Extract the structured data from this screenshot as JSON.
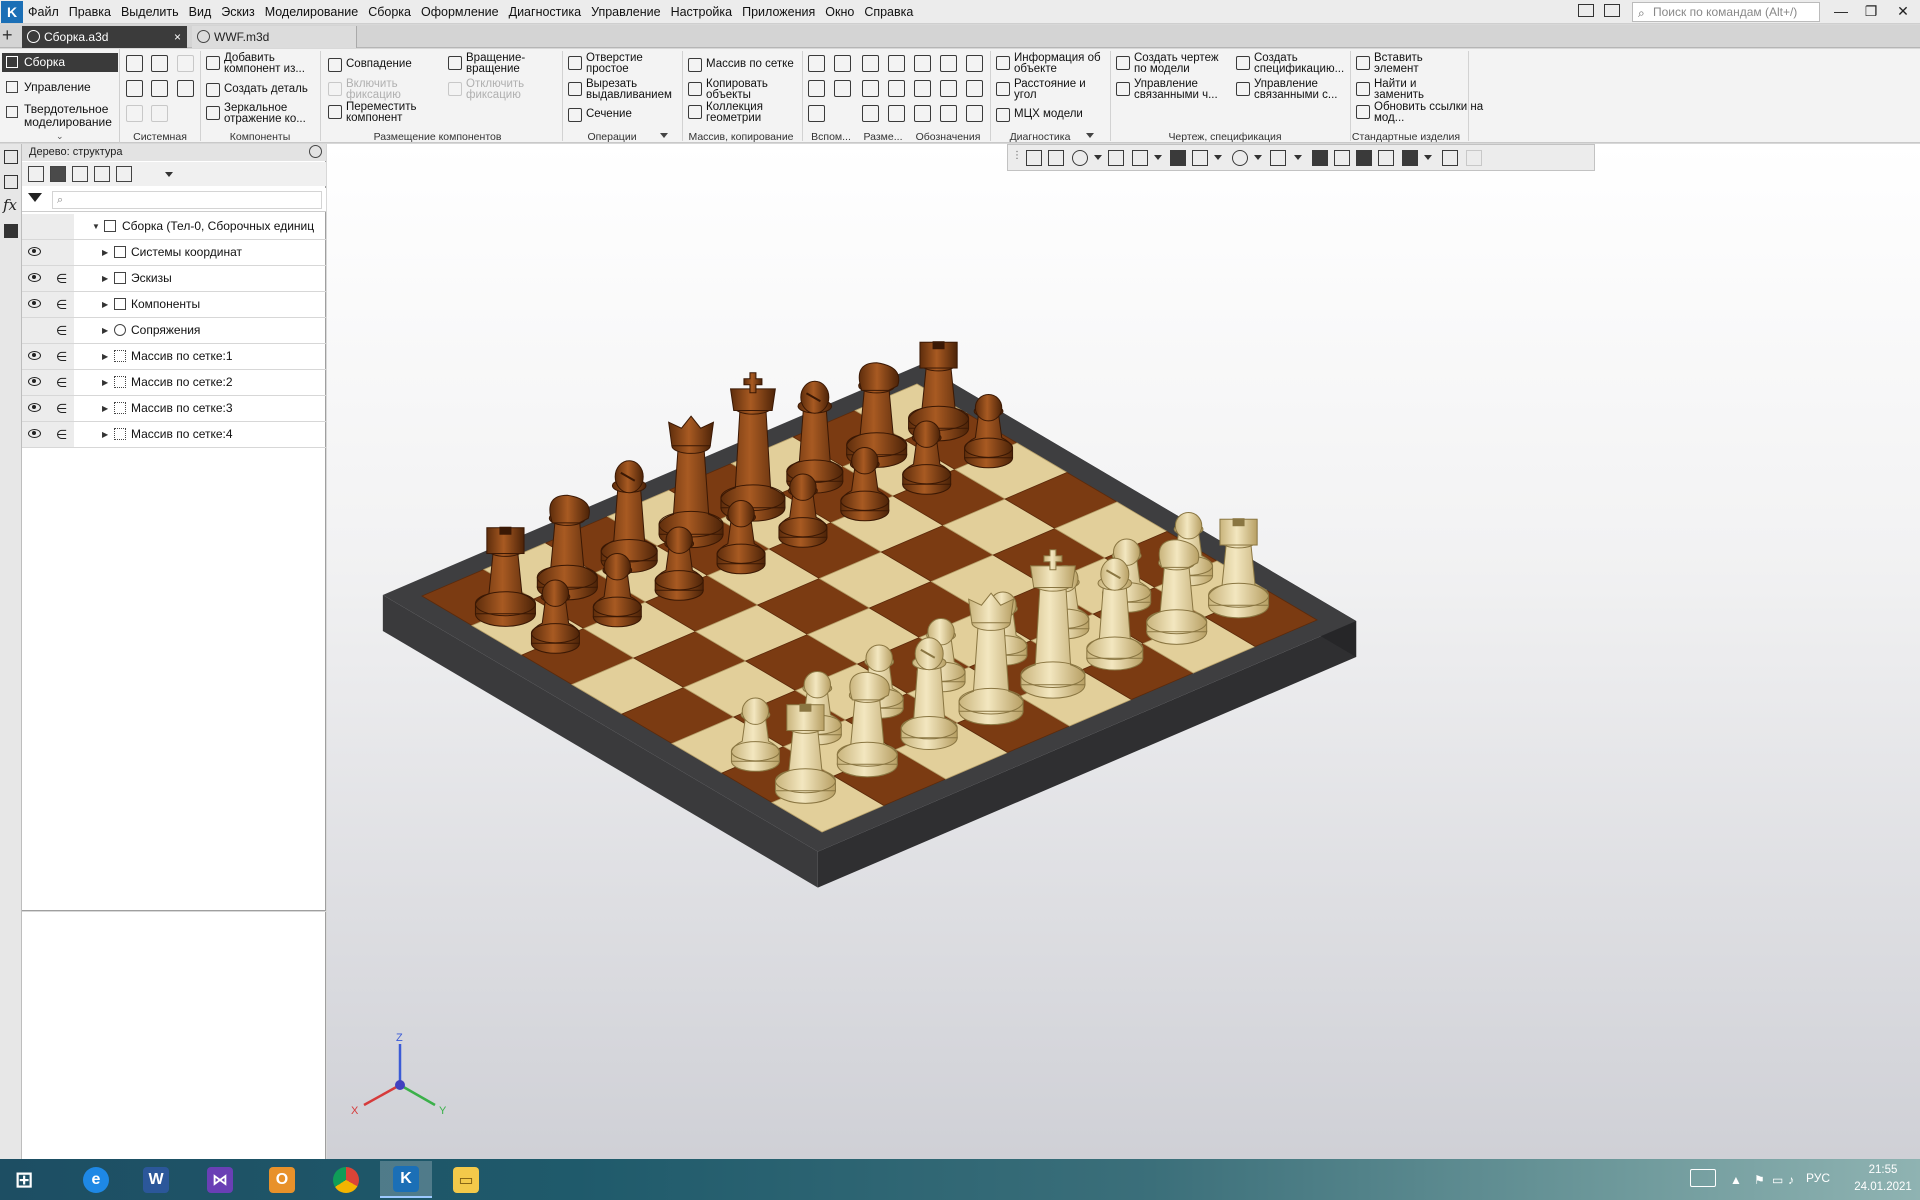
{
  "menubar": {
    "items": [
      "Файл",
      "Правка",
      "Выделить",
      "Вид",
      "Эскиз",
      "Моделирование",
      "Сборка",
      "Оформление",
      "Диагностика",
      "Управление",
      "Настройка",
      "Приложения",
      "Окно",
      "Справка"
    ],
    "search_placeholder": "Поиск по командам (Alt+/)"
  },
  "tabs": [
    {
      "label": "Сборка.a3d",
      "close": "×"
    },
    {
      "label": "WWF.m3d"
    }
  ],
  "ribbon": {
    "modes": [
      "Сборка",
      "Управление",
      "Твердотельное моделирование"
    ],
    "commands": {
      "add_component": "Добавить компонент из...",
      "create_part": "Создать деталь",
      "mirror": "Зеркальное отражение ко...",
      "coincidence": "Совпадение",
      "enable_fix": "Включить фиксацию",
      "move_component": "Переместить компонент",
      "rotation": "Вращение-вращение",
      "disable_fix": "Отключить фиксацию",
      "simple_hole": "Отверстие простое",
      "extrude_cut": "Вырезать выдавливанием",
      "section": "Сечение",
      "grid_array": "Массив по сетке",
      "copy_objects": "Копировать объекты",
      "geom_collection": "Коллекция геометрии",
      "object_info": "Информация об объекте",
      "distance_angle": "Расстояние и угол",
      "mass_props": "МЦХ модели",
      "create_drawing": "Создать чертеж по модели",
      "manage_linked_1": "Управление связанными ч...",
      "create_spec": "Создать спецификацию...",
      "manage_linked_2": "Управление связанными с...",
      "insert_element": "Вставить элемент",
      "find_replace": "Найти и заменить",
      "update_links": "Обновить ссылки на мод..."
    },
    "groups": [
      "Системная",
      "Компоненты",
      "Размещение компонентов",
      "Операции",
      "Массив, копирование",
      "Вспом...",
      "Разме...",
      "Обозначения",
      "Диагностика",
      "Чертеж, спецификация",
      "Стандартные изделия"
    ]
  },
  "tree": {
    "title": "Дерево: структура",
    "rows": [
      "Сборка (Тел-0, Сборочных единиц",
      "Системы координат",
      "Эскизы",
      "Компоненты",
      "Сопряжения",
      "Массив по сетке:1",
      "Массив по сетке:2",
      "Массив по сетке:3",
      "Массив по сетке:4"
    ]
  },
  "axes": {
    "x": "X",
    "y": "Y",
    "z": "Z"
  },
  "taskbar": {
    "apps": [
      "start",
      "internet-explorer",
      "word",
      "visual-studio",
      "outlook",
      "chrome",
      "kompas-3d",
      "file-explorer"
    ],
    "lang": "РУС",
    "time": "21:55",
    "date": "24.01.2021"
  },
  "colors": {
    "light_square": "#e2cf9a",
    "dark_square": "#7b3b12",
    "light_piece": "#e6d7a6",
    "dark_piece": "#8a4516",
    "board_frame": "#3e3e40"
  }
}
